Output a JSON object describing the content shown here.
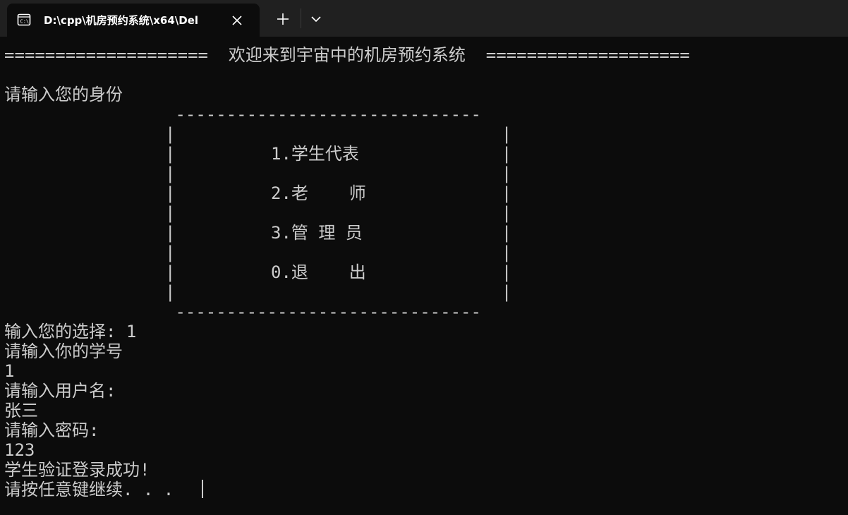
{
  "tab": {
    "title": "D:\\cpp\\机房预约系统\\x64\\Del",
    "icon": "terminal-icon"
  },
  "toolbar": {
    "new_tab_icon": "plus-icon",
    "dropdown_icon": "chevron-down-icon",
    "close_icon": "close-icon"
  },
  "terminal": {
    "banner": "====================  欢迎来到宇宙中的机房预约系统  ====================",
    "prompt_identity": "请输入您的身份",
    "menu": {
      "top_border": " ------------------------------ ",
      "bottom_border": " ------------------------------ ",
      "side": "|                                |",
      "items": [
        "1.学生代表",
        "2.老    师",
        "3.管 理 员",
        "0.退    出"
      ]
    },
    "output": [
      "输入您的选择: 1",
      "请输入你的学号",
      "1",
      "请输入用户名:",
      "张三",
      "请输入密码:",
      "123",
      "学生验证登录成功!",
      "请按任意键继续. . ."
    ]
  },
  "colors": {
    "background": "#0c0c0c",
    "tabbar": "#202020",
    "text": "#cccccc",
    "title": "#ffffff"
  }
}
